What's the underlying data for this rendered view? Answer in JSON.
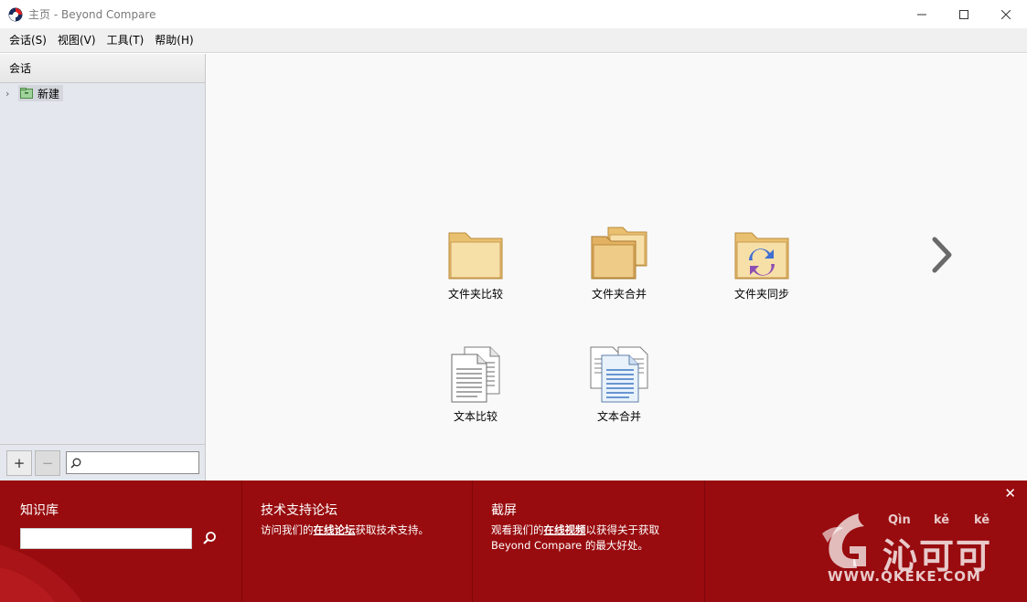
{
  "window": {
    "title": "主页 - Beyond Compare",
    "minimize": "—",
    "maximize": "☐",
    "close": "✕"
  },
  "menu": [
    "会话(S)",
    "视图(V)",
    "工具(T)",
    "帮助(H)"
  ],
  "sidebar": {
    "header": "会话",
    "tree": [
      {
        "label": "新建",
        "expanded": false
      }
    ],
    "add_label": "+",
    "remove_label": "−",
    "search_placeholder": ""
  },
  "launchers": [
    {
      "label": "文件夹比较",
      "icon": "folder-icon"
    },
    {
      "label": "文件夹合并",
      "icon": "folder-merge-icon"
    },
    {
      "label": "文件夹同步",
      "icon": "folder-sync-icon"
    },
    {
      "label": "文本比较",
      "icon": "text-compare-icon"
    },
    {
      "label": "文本合并",
      "icon": "text-merge-icon"
    }
  ],
  "footer": {
    "knowledge": {
      "title": "知识库",
      "search_value": ""
    },
    "forum": {
      "title": "技术支持论坛",
      "text_before": "访问我们的",
      "link": "在线论坛",
      "text_after": "获取技术支持。"
    },
    "screenshot": {
      "title": "截屏",
      "text_before": "观看我们的",
      "link": "在线视频",
      "text_after": "以获得关于获取",
      "line2": "Beyond Compare 的最大好处。"
    },
    "close": "✕"
  },
  "watermark": {
    "pinyin1": "Qìn",
    "pinyin2": "kě",
    "pinyin3": "kě",
    "chars": "沁可可",
    "url": "WWW.QKEKE.COM"
  },
  "colors": {
    "footer_bg": "#980b0e",
    "folder": "#f3d08a",
    "sidebar_bg": "#e4e7ee"
  }
}
